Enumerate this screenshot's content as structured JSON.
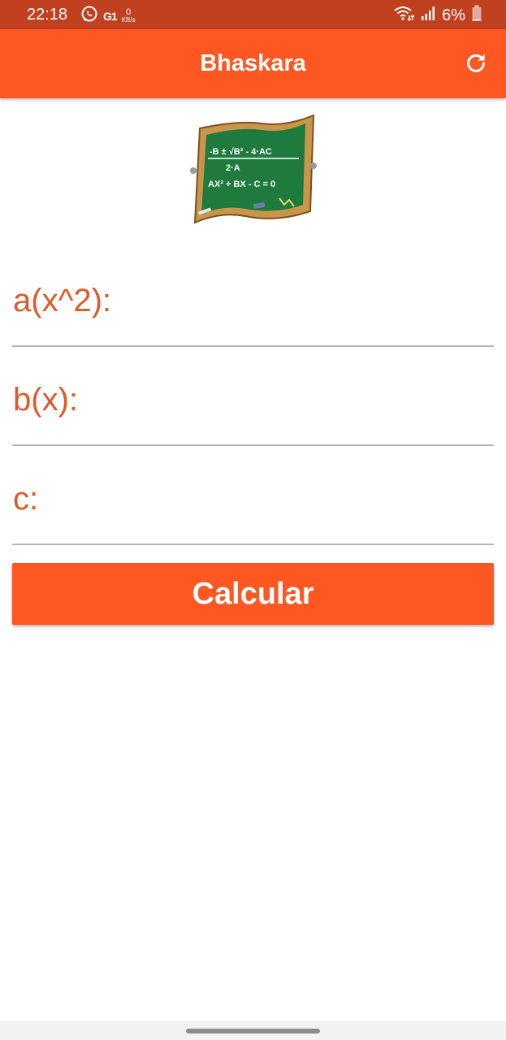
{
  "status_bar": {
    "time": "22:18",
    "carrier_badge": "G1",
    "speed_value": "0",
    "speed_unit": "KB/s",
    "battery": "6%",
    "icons": [
      "whatsapp-icon",
      "wifi-icon",
      "signal-icon",
      "battery-icon"
    ]
  },
  "app_bar": {
    "title": "Bhaskara",
    "refresh_icon": "refresh-icon"
  },
  "board_image": {
    "formula_line1": "-B ± √B² - 4·AC",
    "formula_line2": "2·A",
    "formula_line3": "AX² + BX - C = 0"
  },
  "form": {
    "fields": [
      {
        "label": "a(x^2):",
        "value": ""
      },
      {
        "label": "b(x):",
        "value": ""
      },
      {
        "label": "c:",
        "value": ""
      }
    ],
    "submit_label": "Calcular"
  },
  "colors": {
    "status_bar": "#c1401f",
    "primary": "#ff5722",
    "label": "#e0592b"
  }
}
